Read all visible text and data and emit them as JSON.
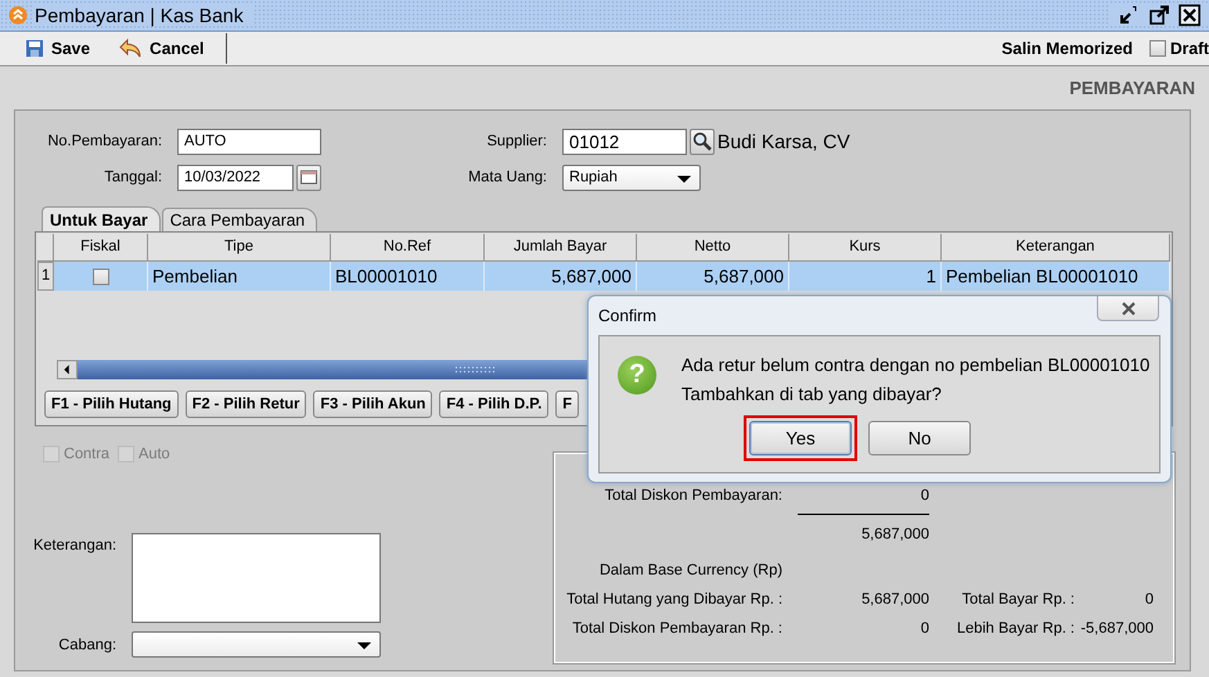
{
  "window": {
    "title": "Pembayaran | Kas Bank"
  },
  "toolbar": {
    "buttons": [
      {
        "label": "Save",
        "kind": "save"
      },
      {
        "label": "Cancel",
        "kind": "cancel"
      }
    ],
    "memorized": "Salin Memorized",
    "draft": {
      "label": "Draft",
      "checked": false
    }
  },
  "page_title": "PEMBAYARAN",
  "form": {
    "no_pembayaran": {
      "label": "No.Pembayaran:",
      "value": "AUTO"
    },
    "supplier": {
      "label": "Supplier:",
      "value": "01012",
      "name": "Budi Karsa, CV"
    },
    "tanggal": {
      "label": "Tanggal:",
      "value": "10/03/2022"
    },
    "mata_uang": {
      "label": "Mata Uang:",
      "value": "Rupiah"
    }
  },
  "tabs": [
    {
      "label": "Untuk Bayar",
      "selected": true
    },
    {
      "label": "Cara Pembayaran",
      "selected": false
    }
  ],
  "table": {
    "columns": [
      "Fiskal",
      "Tipe",
      "No.Ref",
      "Jumlah Bayar",
      "Netto",
      "Kurs",
      "Keterangan"
    ],
    "rows": [
      {
        "number": "1",
        "fiskal": false,
        "tipe": "Pembelian",
        "no_ref": "BL00001010",
        "jumlah_bayar": "5,687,000",
        "netto": "5,687,000",
        "kurs": "1",
        "keterangan": "Pembelian BL00001010",
        "selected": true
      }
    ]
  },
  "action_buttons": [
    "F1 - Pilih Hutang",
    "F2 - Pilih Retur",
    "F3 - Pilih Akun",
    "F4 - Pilih D.P.",
    "F"
  ],
  "options": [
    {
      "label": "Contra",
      "checked": false,
      "disabled": true
    },
    {
      "label": "Auto",
      "checked": false,
      "disabled": true
    }
  ],
  "keterangan": {
    "label": "Keterangan:"
  },
  "cabang": {
    "label": "Cabang:"
  },
  "summary": {
    "total_diskon": {
      "label": "Total Diskon Pembayaran:",
      "value": "0"
    },
    "subtotal": "5,687,000",
    "base_currency": "Dalam Base Currency (Rp)",
    "rows": [
      {
        "label": "Total Hutang yang Dibayar Rp. :",
        "value": "5,687,000",
        "label_2": "Total Bayar Rp. :",
        "value_2": "0"
      },
      {
        "label": "Total Diskon Pembayaran Rp. :",
        "value": "0",
        "label_2": "Lebih Bayar Rp. :",
        "value_2": "-5,687,000"
      }
    ]
  },
  "dialog": {
    "title": "Confirm",
    "icon_glyph": "?",
    "message": [
      "Ada retur belum contra dengan no pembelian BL00001010",
      "Tambahkan di tab yang dibayar?"
    ],
    "buttons": [
      {
        "label": "Yes",
        "selected": true
      },
      {
        "label": "No",
        "selected": false
      }
    ]
  }
}
